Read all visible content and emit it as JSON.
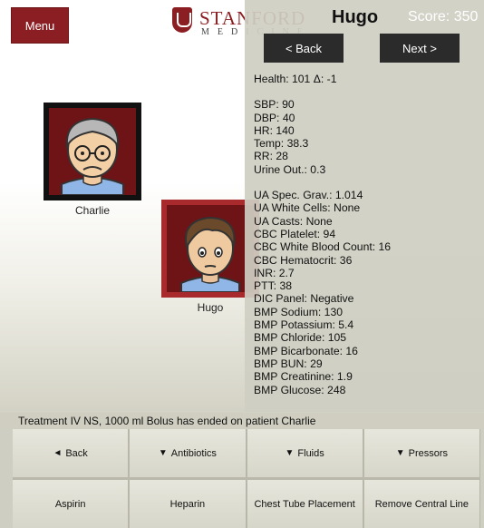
{
  "menu": {
    "label": "Menu"
  },
  "logo": {
    "word": "STANFORD",
    "sub": "MEDICINE"
  },
  "patients": [
    {
      "name": "Charlie"
    },
    {
      "name": "Hugo"
    }
  ],
  "panel": {
    "title": "Hugo",
    "score": "Score: 350",
    "back_label": "< Back",
    "next_label": "Next >",
    "health": "Health: 101   Δ: -1",
    "vitals": [
      "SBP: 90",
      "DBP: 40",
      "HR: 140",
      "Temp: 38.3",
      "RR: 28",
      "Urine Out.: 0.3"
    ],
    "labs": [
      "UA Spec. Grav.: 1.014",
      "UA White Cells: None",
      "UA Casts: None",
      "CBC Platelet: 94",
      "CBC White Blood Count: 16",
      "CBC Hematocrit: 36",
      "INR: 2.7",
      "PTT: 38",
      "DIC Panel: Negative",
      "BMP Sodium: 130",
      "BMP Potassium: 5.4",
      "BMP Chloride: 105",
      "BMP Bicarbonate: 16",
      "BMP BUN: 29",
      "BMP Creatinine: 1.9",
      "BMP Glucose: 248"
    ]
  },
  "status": "Treatment IV NS, 1000 ml Bolus has ended on patient Charlie",
  "actions": [
    {
      "label": "Back",
      "prefix": "◄"
    },
    {
      "label": "Antibiotics",
      "prefix": "▼"
    },
    {
      "label": "Fluids",
      "prefix": "▼"
    },
    {
      "label": "Pressors",
      "prefix": "▼"
    },
    {
      "label": "Aspirin",
      "prefix": ""
    },
    {
      "label": "Heparin",
      "prefix": ""
    },
    {
      "label": "Chest Tube Placement",
      "prefix": ""
    },
    {
      "label": "Remove Central Line",
      "prefix": ""
    }
  ],
  "colors": {
    "brand": "#8b1e22",
    "panel_bg": "#cecec2",
    "button_dark": "#2b2b2b"
  }
}
